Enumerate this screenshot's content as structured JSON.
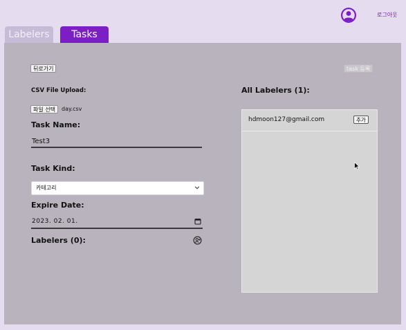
{
  "header": {
    "logout_label": "로그아웃",
    "avatar_icon": "user-circle-icon",
    "accent_color": "#6b1fb1"
  },
  "tabs": [
    {
      "label": "Labelers",
      "active": false
    },
    {
      "label": "Tasks",
      "active": true
    }
  ],
  "form": {
    "back_label": "뒤로가기",
    "task_register_label": "task 등록",
    "csv_label": "CSV File Upload:",
    "file_button_label": "파일 선택",
    "file_name": "day.csv",
    "task_name_label": "Task Name:",
    "task_name_value": "Test3",
    "task_kind_label": "Task Kind:",
    "task_kind_value": "카테고리",
    "expire_label": "Expire Date:",
    "expire_value": "2023. 02. 01.",
    "labelers_label": "Labelers (0):"
  },
  "all_labelers": {
    "title": "All Labelers (1):",
    "items": [
      {
        "email": "hdmoon127@gmail.com",
        "add_label": "추가"
      }
    ]
  }
}
